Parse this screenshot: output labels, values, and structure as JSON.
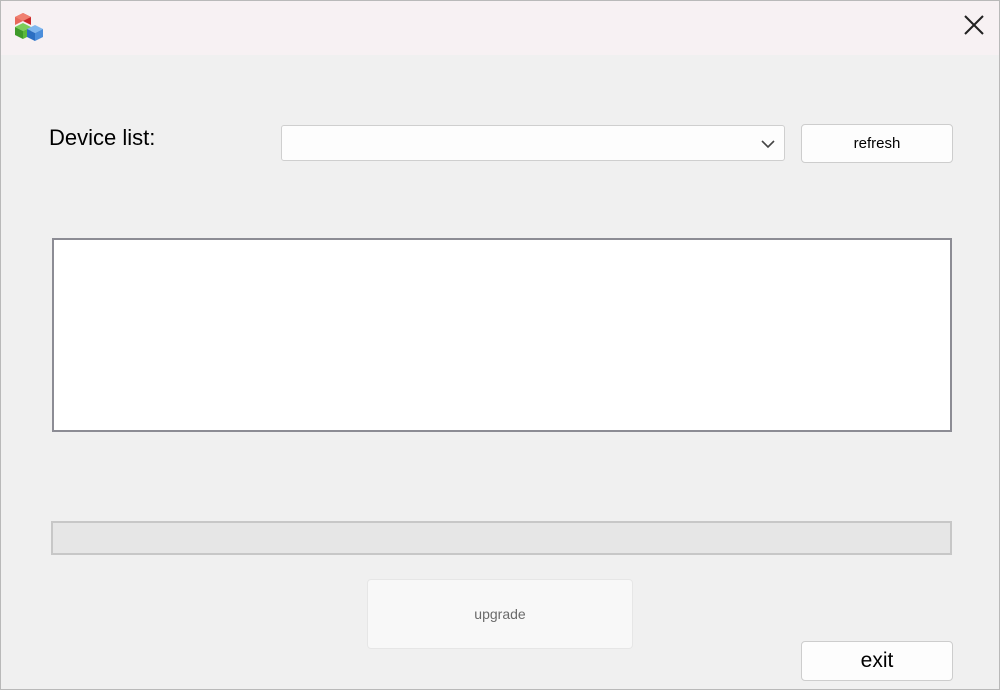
{
  "window": {
    "icon": "app-cubes-icon",
    "close_icon": "close-icon"
  },
  "device": {
    "label": "Device list:",
    "selected": "",
    "dropdown_icon": "chevron-down-icon"
  },
  "buttons": {
    "refresh": "refresh",
    "upgrade": "upgrade",
    "exit": "exit"
  },
  "log": {
    "text": ""
  },
  "progress": {
    "value_percent": 0,
    "fill_color": "#06b025"
  }
}
